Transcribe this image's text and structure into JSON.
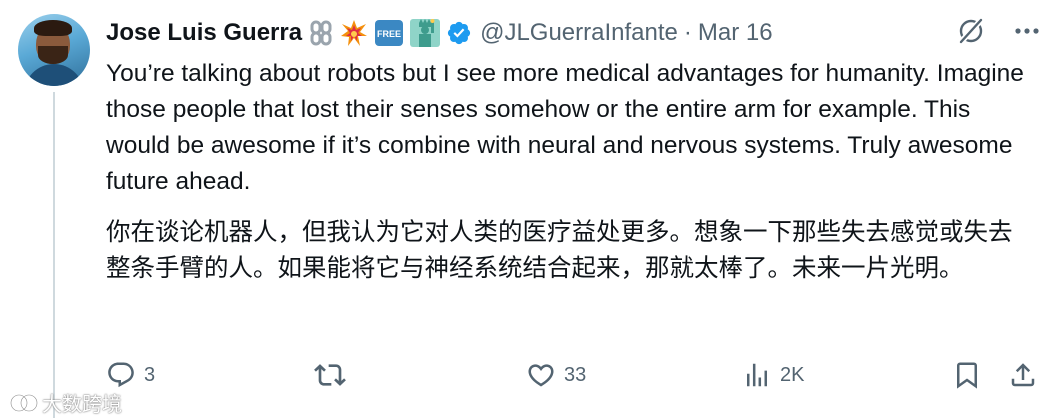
{
  "tweet": {
    "author_name": "Jose Luis Guerra",
    "handle": "@JLGuerraInfante",
    "separator": "·",
    "date": "Mar 16",
    "badges": [
      "chain-emoji",
      "collision-emoji",
      "free-button-emoji",
      "statue-of-liberty-emoji",
      "verified-badge"
    ],
    "badge_texts": {
      "free": "FREE"
    },
    "body_en": "You’re talking about robots but I see more medical advantages for humanity. Imagine those people that lost their senses somehow or the entire arm for example. This would be awesome if it’s combine with neural and nervous systems. Truly awesome future ahead.",
    "body_zh": "你在谈论机器人，但我认为它对人类的医疗益处更多。想象一下那些失去感觉或失去整条手臂的人。如果能将它与神经系统结合起来，那就太棒了。未来一片光明。"
  },
  "actions": {
    "replies": "3",
    "reposts": "",
    "likes": "33",
    "views": "2K"
  },
  "watermark": {
    "text": "大数跨境"
  },
  "colors": {
    "text": "#0f1419",
    "muted": "#536471",
    "verified": "#1d9bf0",
    "thread_line": "#cfd9de"
  }
}
